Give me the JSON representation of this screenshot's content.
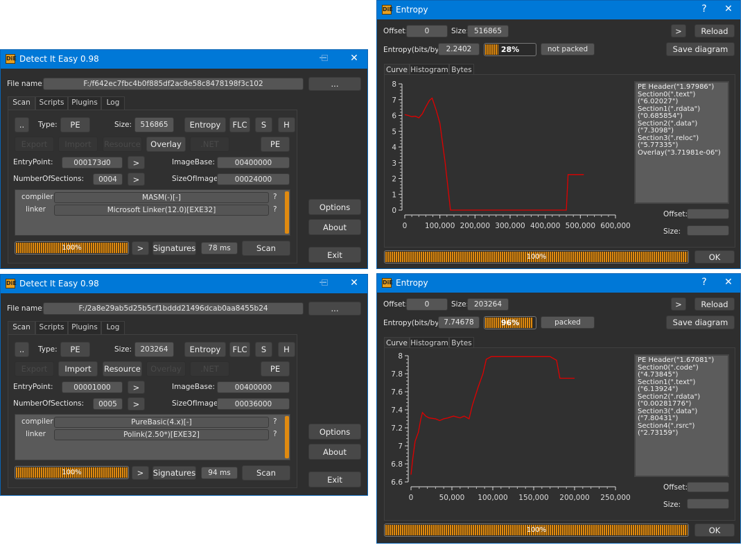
{
  "die_windows": [
    {
      "title": "Detect It Easy 0.98",
      "logo": "DiE",
      "file_label": "File name:",
      "file_name": "F:/f642ec7fbc4b0f885df2ac8e58c8478198f3c102",
      "browse": "...",
      "tabs": [
        "Scan",
        "Scripts",
        "Plugins",
        "Log"
      ],
      "up": "..",
      "type_label": "Type:",
      "type": "PE",
      "size_label": "Size:",
      "size": "516865",
      "entropy": "Entropy",
      "flc": "FLC",
      "s": "S",
      "h": "H",
      "row2": [
        {
          "label": "Export",
          "enabled": false
        },
        {
          "label": "Import",
          "enabled": false
        },
        {
          "label": "Resource",
          "enabled": false
        },
        {
          "label": "Overlay",
          "enabled": true
        },
        {
          "label": ".NET",
          "enabled": false
        }
      ],
      "pe": "PE",
      "entry_label": "EntryPoint:",
      "entry": "000173d0",
      "go": ">",
      "image_base_label": "ImageBase:",
      "image_base": "00400000",
      "sections_label": "NumberOfSections:",
      "sections": "0004",
      "size_of_image_label": "SizeOfImage:",
      "size_of_image": "00024000",
      "results": [
        {
          "type": "compiler",
          "name": "MASM(-)[-]",
          "help": "?"
        },
        {
          "type": "linker",
          "name": "Microsoft Linker(12.0)[EXE32]",
          "help": "?"
        }
      ],
      "progress": 100,
      "progress_text": "100%",
      "signatures": "Signatures",
      "time": "78 ms",
      "scan": "Scan",
      "options": "Options",
      "about": "About",
      "exit": "Exit"
    },
    {
      "title": "Detect It Easy 0.98",
      "logo": "DiE",
      "file_label": "File name:",
      "file_name": "F:/2a8e29ab5d25b5cf1bddd21496dcab0aa8455b24",
      "browse": "...",
      "tabs": [
        "Scan",
        "Scripts",
        "Plugins",
        "Log"
      ],
      "up": "..",
      "type_label": "Type:",
      "type": "PE",
      "size_label": "Size:",
      "size": "203264",
      "entropy": "Entropy",
      "flc": "FLC",
      "s": "S",
      "h": "H",
      "row2": [
        {
          "label": "Export",
          "enabled": false
        },
        {
          "label": "Import",
          "enabled": true
        },
        {
          "label": "Resource",
          "enabled": true
        },
        {
          "label": "Overlay",
          "enabled": false
        },
        {
          "label": ".NET",
          "enabled": false
        }
      ],
      "pe": "PE",
      "entry_label": "EntryPoint:",
      "entry": "00001000",
      "go": ">",
      "image_base_label": "ImageBase:",
      "image_base": "00400000",
      "sections_label": "NumberOfSections:",
      "sections": "0005",
      "size_of_image_label": "SizeOfImage:",
      "size_of_image": "00036000",
      "results": [
        {
          "type": "compiler",
          "name": "PureBasic(4.x)[-]",
          "help": "?"
        },
        {
          "type": "linker",
          "name": "Polink(2.50*)[EXE32]",
          "help": "?"
        }
      ],
      "progress": 100,
      "progress_text": "100%",
      "signatures": "Signatures",
      "time": "94 ms",
      "scan": "Scan",
      "options": "Options",
      "about": "About",
      "exit": "Exit"
    }
  ],
  "entropy_windows": [
    {
      "title": "Entropy",
      "logo": "DiE",
      "help": "?",
      "offset_label": "Offset:",
      "offset": "0",
      "size_label": "Size:",
      "size": "516865",
      "next": ">",
      "reload": "Reload",
      "entropy_label": "Entropy(bits/byte):",
      "entropy": "2.2402",
      "percent": 28,
      "percent_text": "28%",
      "status": "not packed",
      "save": "Save diagram",
      "tabs": [
        "Curve",
        "Histogram",
        "Bytes"
      ],
      "sections": [
        "PE Header(\"1.97986\")",
        "Section0(\".text\")(\"6.02027\")",
        "Section1(\".rdata\")(\"0.685854\")",
        "Section2(\".data\")(\"7.3098\")",
        "Section3(\".reloc\")(\"5.77335\")",
        "Overlay(\"3.71981e-06\")"
      ],
      "sel_offset_label": "Offset:",
      "sel_size_label": "Size:",
      "progress": 100,
      "progress_text": "100%",
      "ok": "OK"
    },
    {
      "title": "Entropy",
      "logo": "DiE",
      "help": "?",
      "offset_label": "Offset:",
      "offset": "0",
      "size_label": "Size:",
      "size": "203264",
      "next": ">",
      "reload": "Reload",
      "entropy_label": "Entropy(bits/byte):",
      "entropy": "7.74678",
      "percent": 96,
      "percent_text": "96%",
      "status": "packed",
      "save": "Save diagram",
      "tabs": [
        "Curve",
        "Histogram",
        "Bytes"
      ],
      "sections": [
        "PE Header(\"1.67081\")",
        "Section0(\".code\")(\"4.73845\")",
        "Section1(\".text\")(\"6.13924\")",
        "Section2(\".rdata\")(\"0.00281776\")",
        "Section3(\".data\")(\"7.80431\")",
        "Section4(\".rsrc\")(\"2.73159\")"
      ],
      "sel_offset_label": "Offset:",
      "sel_size_label": "Size:",
      "progress": 100,
      "progress_text": "100%",
      "ok": "OK"
    }
  ],
  "colors": {
    "title_bar": "#0078d7",
    "curve": "#e00000",
    "progress": "#e08a10"
  },
  "chart_data": [
    {
      "type": "line",
      "xlim": [
        0,
        600000
      ],
      "ylim": [
        0,
        8
      ],
      "xticks": [
        0,
        100000,
        200000,
        300000,
        400000,
        500000,
        600000
      ],
      "xtick_labels": [
        "0",
        "100,000",
        "200,000",
        "300,000",
        "400,000",
        "500,000",
        "600,000"
      ],
      "yticks": [
        0,
        1,
        2,
        3,
        4,
        5,
        6,
        7,
        8
      ],
      "ytick_labels": [
        "0",
        "1",
        "2",
        "3",
        "4",
        "5",
        "6",
        "7",
        "8"
      ],
      "grid": false,
      "x": [
        0,
        10000,
        20000,
        30000,
        40000,
        50000,
        60000,
        70000,
        78000,
        90000,
        100000,
        115000,
        130000,
        460000,
        465000,
        510000
      ],
      "y": [
        6.05,
        6.0,
        5.92,
        5.95,
        5.85,
        6.1,
        6.55,
        6.95,
        7.1,
        6.3,
        5.5,
        3.0,
        0,
        0,
        2.25,
        2.25
      ]
    },
    {
      "type": "line",
      "xlim": [
        0,
        250000
      ],
      "ylim": [
        6.6,
        8
      ],
      "xticks": [
        0,
        50000,
        100000,
        150000,
        200000,
        250000
      ],
      "xtick_labels": [
        "0",
        "50,000",
        "100,000",
        "150,000",
        "200,000",
        "250,000"
      ],
      "yticks": [
        6.6,
        6.8,
        7,
        7.2,
        7.4,
        7.6,
        7.8,
        8
      ],
      "ytick_labels": [
        "6.6",
        "6.8",
        "7",
        "7.2",
        "7.4",
        "7.6",
        "7.8",
        "8"
      ],
      "grid": false,
      "x": [
        0,
        2000,
        5000,
        9000,
        12000,
        14000,
        18000,
        22000,
        30000,
        35000,
        40000,
        45000,
        52000,
        60000,
        65000,
        71000,
        75000,
        82000,
        88000,
        92000,
        98000,
        130000,
        170000,
        178000,
        182000,
        200000
      ],
      "y": [
        6.68,
        6.85,
        7.05,
        7.15,
        7.3,
        7.37,
        7.33,
        7.31,
        7.3,
        7.28,
        7.3,
        7.31,
        7.33,
        7.31,
        7.33,
        7.3,
        7.45,
        7.65,
        7.8,
        7.96,
        7.99,
        7.99,
        7.99,
        7.95,
        7.75,
        7.75
      ]
    }
  ]
}
